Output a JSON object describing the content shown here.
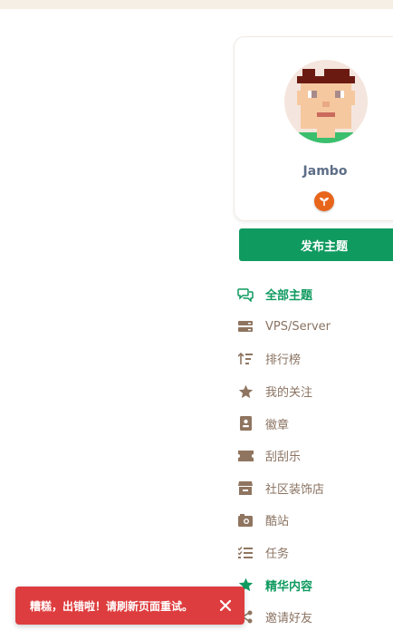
{
  "profile": {
    "username": "Jambo",
    "badge_icon": "sprout-icon",
    "badge_color": "#e8651c"
  },
  "actions": {
    "publish_label": "发布主题"
  },
  "nav": [
    {
      "label": "全部主题",
      "icon": "chat-bubbles-icon",
      "state": "active"
    },
    {
      "label": "VPS/Server",
      "icon": "server-icon",
      "state": "normal"
    },
    {
      "label": "排行榜",
      "icon": "sort-ranking-icon",
      "state": "normal"
    },
    {
      "label": "我的关注",
      "icon": "star-icon",
      "state": "normal"
    },
    {
      "label": "徽章",
      "icon": "badge-card-icon",
      "state": "normal"
    },
    {
      "label": "刮刮乐",
      "icon": "ticket-icon",
      "state": "normal"
    },
    {
      "label": "社区装饰店",
      "icon": "store-icon",
      "state": "normal"
    },
    {
      "label": "酷站",
      "icon": "camera-icon",
      "state": "normal"
    },
    {
      "label": "任务",
      "icon": "task-list-icon",
      "state": "normal"
    },
    {
      "label": "精华内容",
      "icon": "star-icon",
      "state": "featured"
    },
    {
      "label": "邀请好友",
      "icon": "share-icon",
      "state": "normal"
    }
  ],
  "toast": {
    "message": "糟糕，出错啦！请刷新页面重试。",
    "close_icon": "close-icon"
  },
  "colors": {
    "accent": "#0f9a5f",
    "nav_text": "#8a7362",
    "icon_muted": "#8f7560",
    "error": "#de3d3f",
    "topbar": "#f6efe6"
  }
}
